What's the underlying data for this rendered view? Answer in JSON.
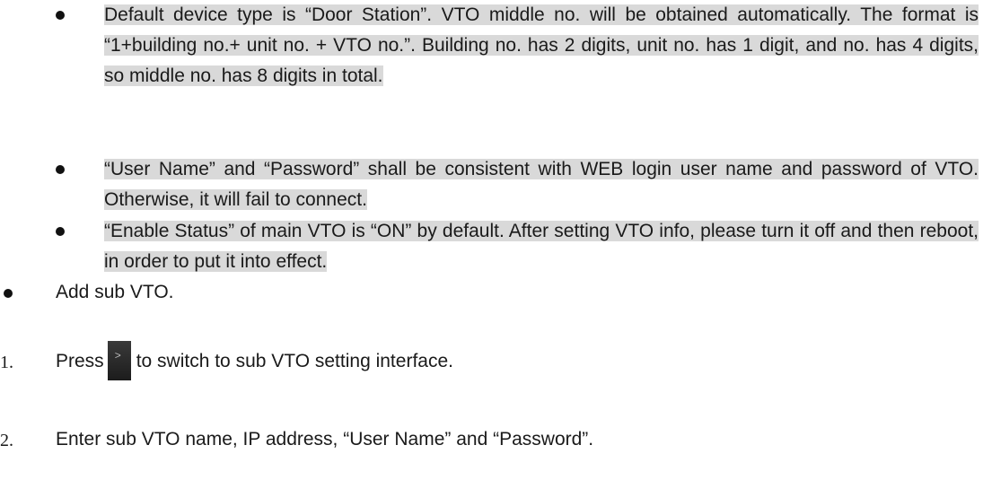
{
  "notes": [
    {
      "text": "Default device type is “Door Station”. VTO middle no. will be obtained automatically. The format is “1+building no.+ unit no. + VTO no.”. Building no. has 2 digits, unit no. has 1 digit, and no. has 4 digits, so middle no. has 8 digits in total."
    },
    {
      "text": "“User Name” and “Password” shall be consistent with WEB login user name and password of VTO. Otherwise, it will fail to connect."
    },
    {
      "text": "“Enable Status” of main VTO is “ON” by default. After setting VTO info, please turn it off and then reboot, in order to put it into effect."
    }
  ],
  "section": {
    "text": "Add sub VTO."
  },
  "steps": [
    {
      "num": "1.",
      "before": "Press",
      "icon": "chevron-right-icon",
      "after": "to switch to sub VTO setting interface."
    },
    {
      "num": "2.",
      "text": "Enter sub VTO name, IP address, “User Name” and “Password”."
    }
  ]
}
